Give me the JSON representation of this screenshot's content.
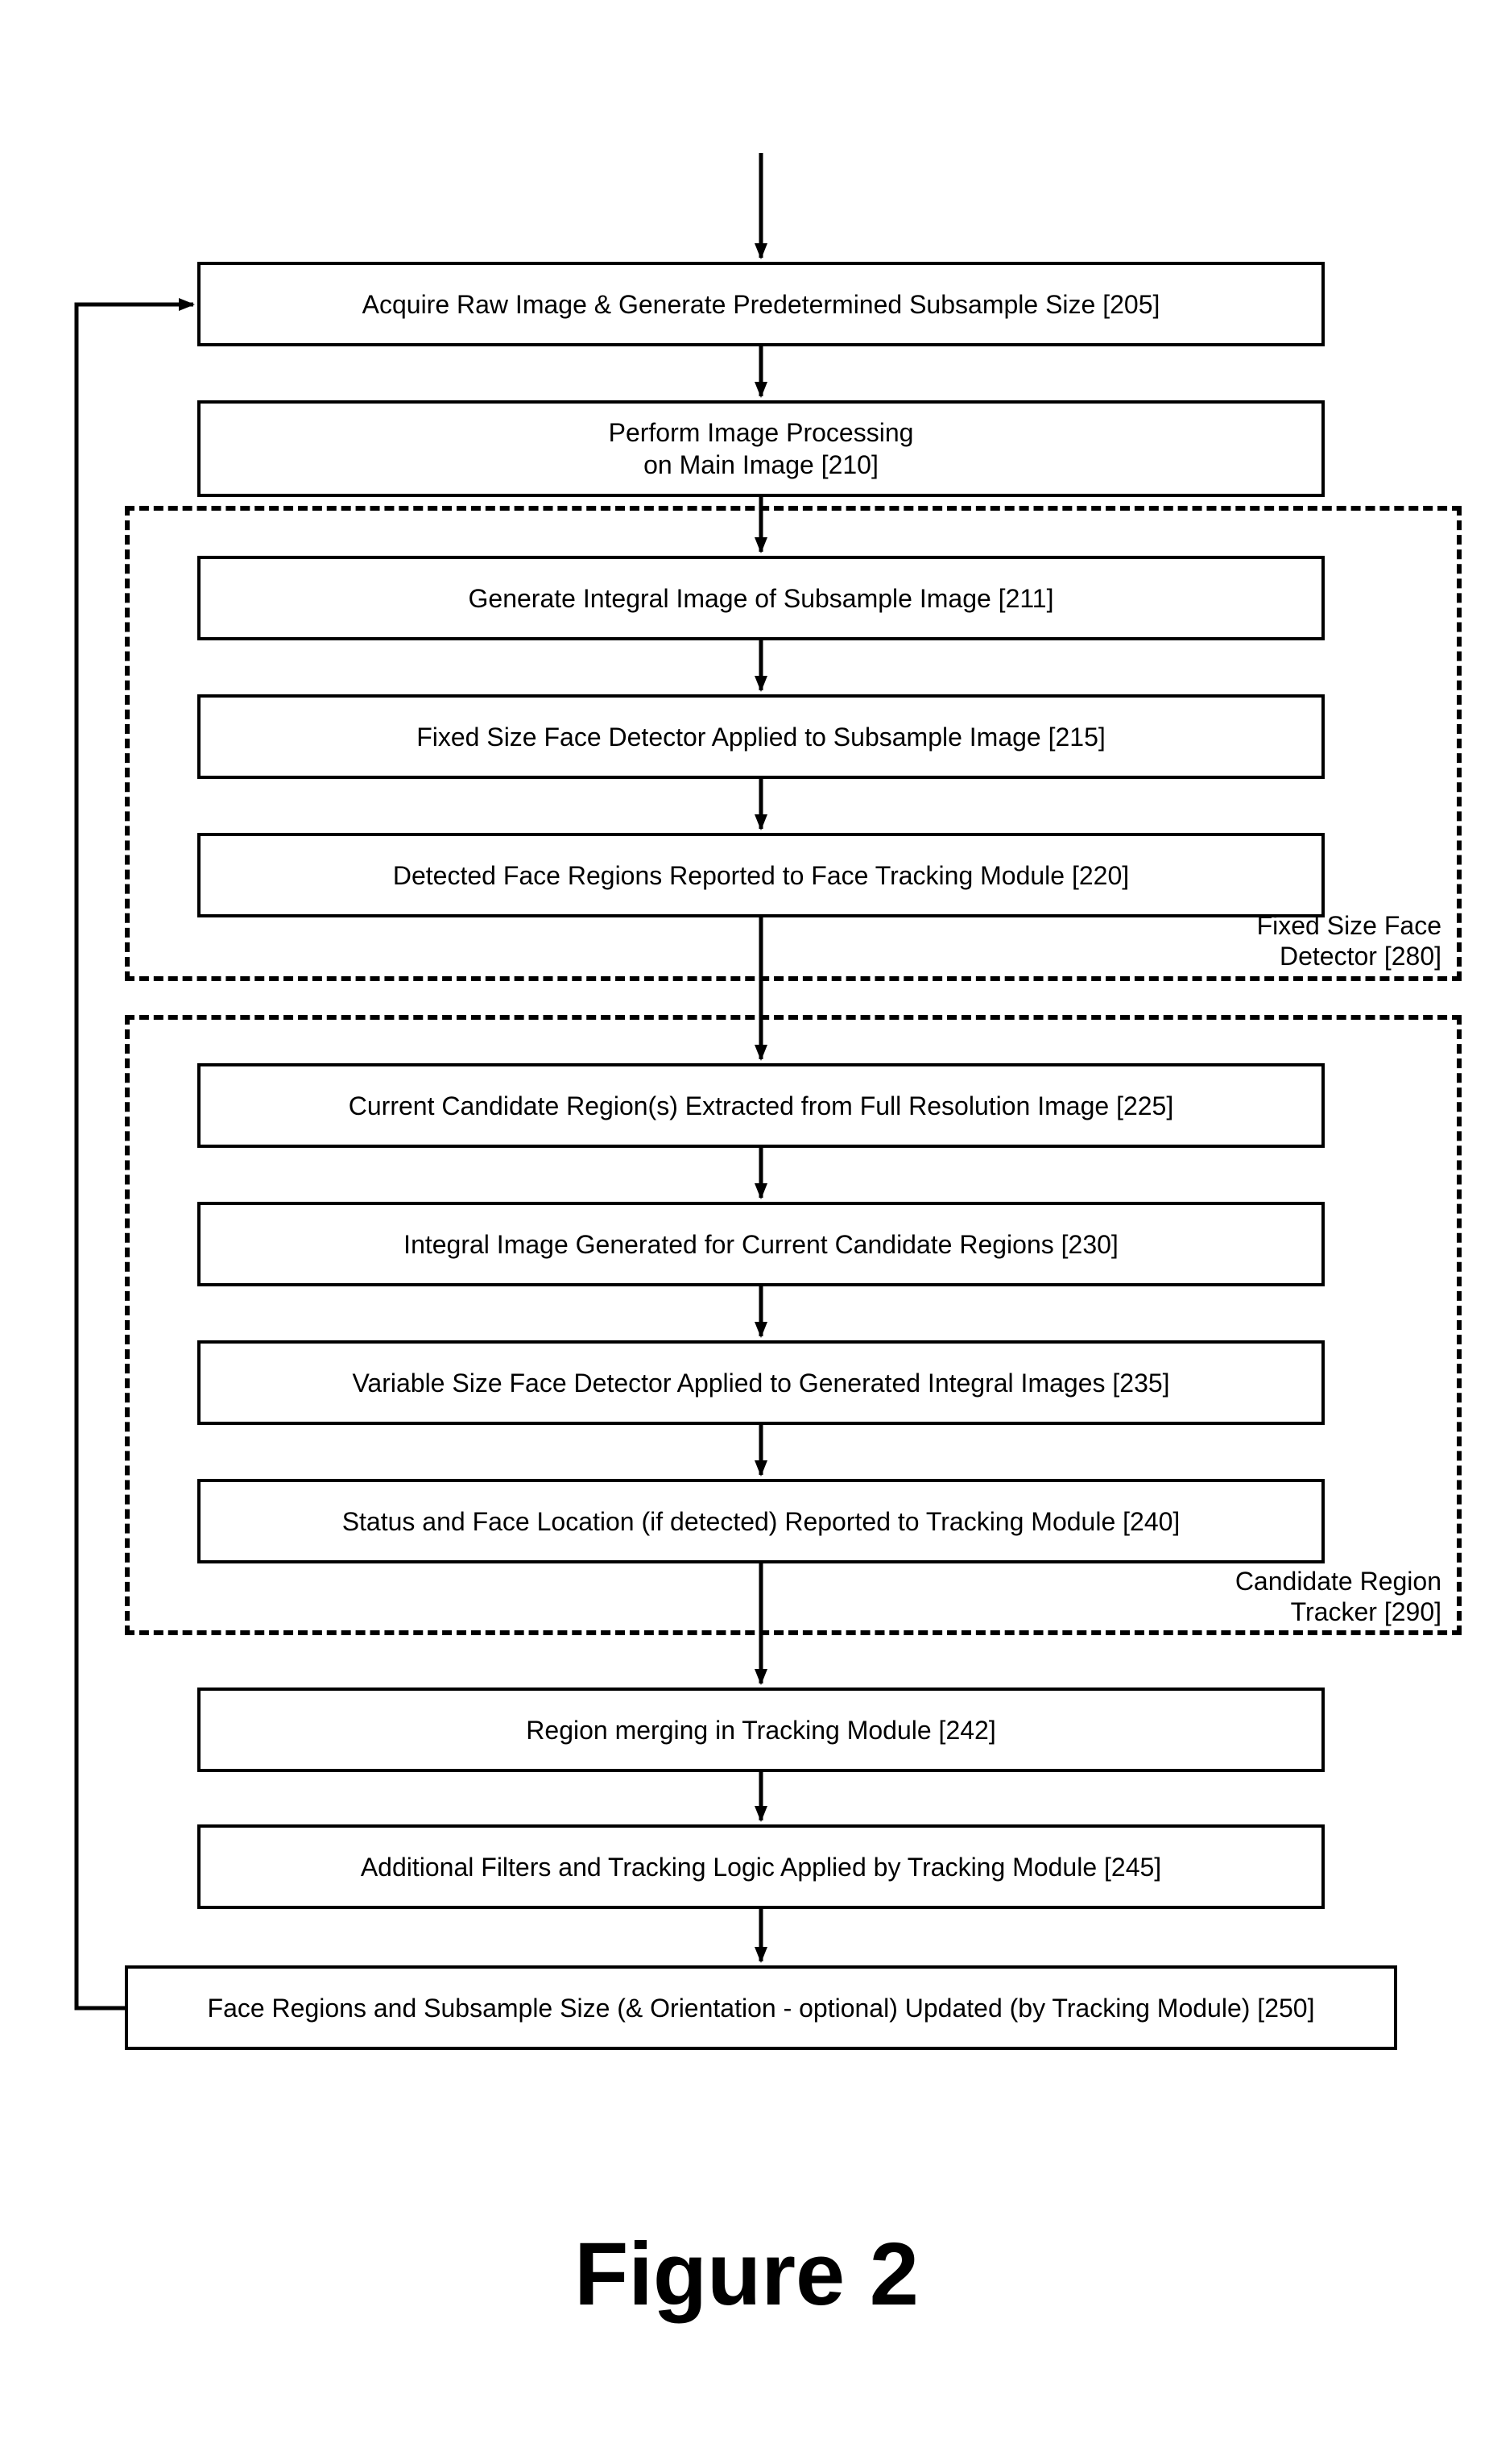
{
  "figure_title": "Figure 2",
  "boxes": {
    "b205": "Acquire Raw Image & Generate Predetermined Subsample Size [205]",
    "b210_line1": "Perform Image Processing",
    "b210_line2": "on Main Image [210]",
    "b211": "Generate Integral Image of Subsample Image [211]",
    "b215": "Fixed Size Face Detector Applied to Subsample Image [215]",
    "b220": "Detected Face Regions Reported to Face Tracking Module [220]",
    "b225": "Current Candidate Region(s) Extracted from Full Resolution Image [225]",
    "b230": "Integral Image Generated for Current Candidate Regions [230]",
    "b235": "Variable Size Face Detector Applied to Generated Integral Images [235]",
    "b240": "Status and Face Location (if detected) Reported to Tracking Module [240]",
    "b242": "Region merging in Tracking Module [242]",
    "b245": "Additional Filters and Tracking Logic Applied by Tracking Module [245]",
    "b250": "Face Regions and Subsample Size (& Orientation - optional) Updated (by Tracking Module) [250]"
  },
  "groups": {
    "g280_line1": "Fixed Size Face",
    "g280_line2": "Detector [280]",
    "g290_line1": "Candidate Region",
    "g290_line2": "Tracker [290]"
  },
  "chart_data": {
    "type": "flowchart",
    "title": "Figure 2",
    "nodes": [
      {
        "id": "205",
        "label": "Acquire Raw Image & Generate Predetermined Subsample Size [205]"
      },
      {
        "id": "210",
        "label": "Perform Image Processing on Main Image [210]"
      },
      {
        "id": "211",
        "label": "Generate Integral Image of Subsample Image [211]"
      },
      {
        "id": "215",
        "label": "Fixed Size Face Detector Applied to Subsample Image [215]"
      },
      {
        "id": "220",
        "label": "Detected Face Regions Reported to Face Tracking Module [220]"
      },
      {
        "id": "225",
        "label": "Current Candidate Region(s) Extracted from Full Resolution Image [225]"
      },
      {
        "id": "230",
        "label": "Integral Image Generated for Current Candidate Regions [230]"
      },
      {
        "id": "235",
        "label": "Variable Size Face Detector Applied to Generated Integral Images [235]"
      },
      {
        "id": "240",
        "label": "Status and Face Location (if detected) Reported to Tracking Module [240]"
      },
      {
        "id": "242",
        "label": "Region merging in Tracking Module [242]"
      },
      {
        "id": "245",
        "label": "Additional Filters and Tracking Logic Applied by Tracking Module [245]"
      },
      {
        "id": "250",
        "label": "Face Regions and Subsample Size (& Orientation - optional) Updated (by Tracking Module) [250]"
      }
    ],
    "groups": [
      {
        "id": "280",
        "label": "Fixed Size Face Detector [280]",
        "contains": [
          "211",
          "215",
          "220"
        ]
      },
      {
        "id": "290",
        "label": "Candidate Region Tracker [290]",
        "contains": [
          "225",
          "230",
          "235",
          "240"
        ]
      }
    ],
    "edges": [
      {
        "from": "start",
        "to": "205"
      },
      {
        "from": "205",
        "to": "210"
      },
      {
        "from": "210",
        "to": "211"
      },
      {
        "from": "211",
        "to": "215"
      },
      {
        "from": "215",
        "to": "220"
      },
      {
        "from": "220",
        "to": "225"
      },
      {
        "from": "225",
        "to": "230"
      },
      {
        "from": "230",
        "to": "235"
      },
      {
        "from": "235",
        "to": "240"
      },
      {
        "from": "240",
        "to": "242"
      },
      {
        "from": "242",
        "to": "245"
      },
      {
        "from": "245",
        "to": "250"
      },
      {
        "from": "250",
        "to": "205",
        "note": "loop back"
      }
    ]
  }
}
